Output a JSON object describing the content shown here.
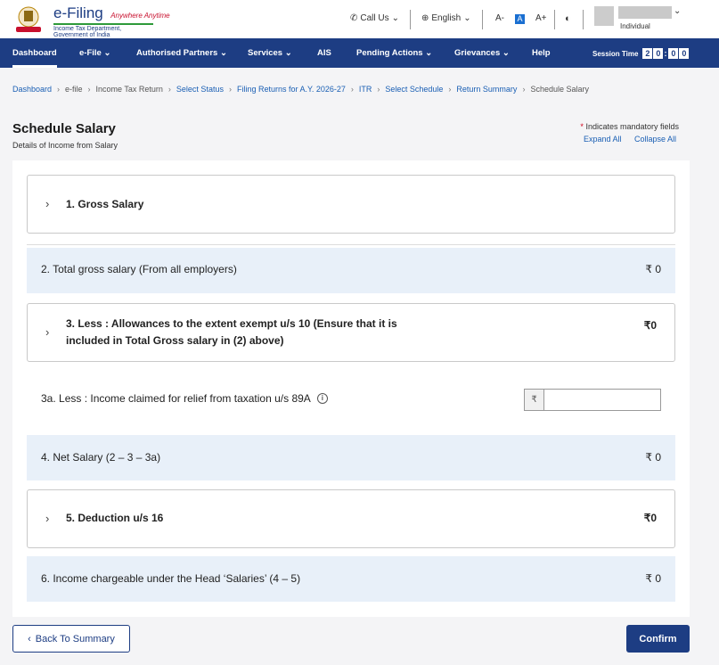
{
  "header": {
    "brand_name": "e-Filing",
    "brand_tagline": "Anywhere Anytime",
    "brand_dept": "Income Tax Department, Government of India",
    "call_us": "Call Us",
    "language": "English",
    "font_small": "A-",
    "font_normal": "A",
    "font_large": "A+",
    "user_type": "Individual"
  },
  "nav": {
    "items": [
      "Dashboard",
      "e-File",
      "Authorised Partners",
      "Services",
      "AIS",
      "Pending Actions",
      "Grievances",
      "Help"
    ],
    "session_label": "Session Time",
    "session_digits": [
      "2",
      "0",
      "0",
      "0"
    ]
  },
  "breadcrumb": [
    "Dashboard",
    "e-file",
    "Income Tax Return",
    "Select Status",
    "Filing Returns for A.Y. 2026-27",
    "ITR",
    "Select Schedule",
    "Return Summary",
    "Schedule Salary"
  ],
  "page": {
    "title": "Schedule Salary",
    "subtitle": "Details of Income from Salary",
    "mandatory_note": "Indicates mandatory fields",
    "expand_all": "Expand All",
    "collapse_all": "Collapse All"
  },
  "sections": {
    "gross_salary": {
      "title": "1. Gross Salary"
    },
    "total_gross": {
      "label": "2. Total gross salary (From all employers)",
      "amount": "₹ 0"
    },
    "allowances": {
      "title_line1": "3. Less : Allowances to the extent exempt u/s 10 (Ensure that it is",
      "title_line2": "included in Total Gross salary in (2) above)",
      "amount": "₹0"
    },
    "relief": {
      "label": "3a. Less : Income claimed for relief from taxation u/s 89A",
      "currency": "₹",
      "value": ""
    },
    "net_salary": {
      "label": "4. Net Salary (2 – 3 – 3a)",
      "amount": "₹ 0"
    },
    "deduction": {
      "title": "5. Deduction u/s 16",
      "amount": "₹0"
    },
    "chargeable": {
      "label": "6. Income chargeable under the Head ‘Salaries’ (4 – 5)",
      "amount": "₹ 0"
    }
  },
  "footer": {
    "back_label": "Back To Summary",
    "confirm_label": "Confirm"
  },
  "colors": {
    "primary": "#1d3d83",
    "link": "#1a5fb4",
    "row_highlight": "#e8f0f9"
  }
}
